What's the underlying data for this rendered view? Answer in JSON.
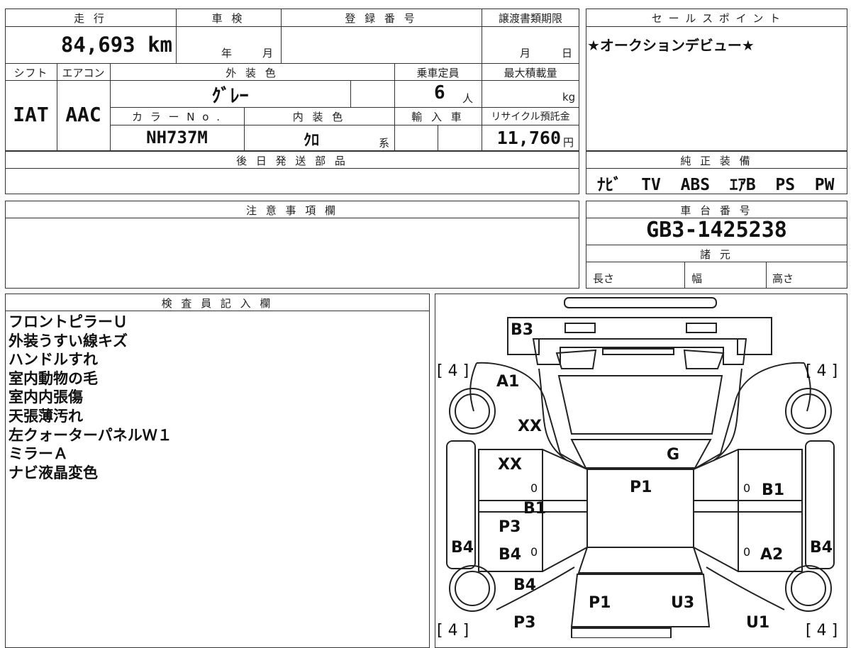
{
  "headers": {
    "mileage": "走 行",
    "inspection": "車 検",
    "registration": "登 録 番 号",
    "transfer_deadline": "譲渡書類期限",
    "sales_point": "セ ー ル ス ポ イ ン ト",
    "shift": "シフト",
    "aircon": "エアコン",
    "exterior_color": "外 装 色",
    "capacity": "乗車定員",
    "max_load": "最大積載量",
    "color_no": "カ ラ ー N o .",
    "interior_color": "内 装 色",
    "import": "輸 入 車",
    "recycle_fee": "リサイクル預託金",
    "later_parts": "後 日 発 送 部 品",
    "genuine_equipment": "純 正 装 備",
    "notes": "注 意 事 項 欄",
    "chassis_no": "車 台 番 号",
    "specs": "諸 元",
    "inspector": "検 査 員 記 入 欄"
  },
  "values": {
    "mileage": "84,693 km",
    "inspection_year": "年",
    "inspection_month": "月",
    "transfer_month": "月",
    "transfer_day": "日",
    "sales_point": "★オークションデビュー★",
    "shift": "IAT",
    "aircon": "AAC",
    "exterior_color": "ｸﾞﾚｰ",
    "capacity": "6",
    "capacity_unit": "人",
    "max_load_unit": "kg",
    "color_no": "NH737M",
    "interior_color": "ｸﾛ",
    "interior_suffix": "系",
    "recycle_fee": "11,760",
    "recycle_unit": "円",
    "genuine_equipment": "ﾅﾋﾞ  TV  ABS  ｴｱB  PS  PW",
    "chassis_no": "GB3-1425238",
    "length_label": "長さ",
    "width_label": "幅",
    "height_label": "高さ"
  },
  "inspector_notes": [
    "フロントピラーＵ",
    "外装うすい線キズ",
    "ハンドルすれ",
    "室内動物の毛",
    "室内内張傷",
    "天張薄汚れ",
    "左クォーターパネルＷ１",
    "ミラーＡ",
    "ナビ液晶変色"
  ],
  "diagram": {
    "b3_top": "B3",
    "tire_fl": "[ 4 ]",
    "tire_fr": "[ 4 ]",
    "tire_rl": "[ 4 ]",
    "tire_rr": "[ 4 ]",
    "a1": "A1",
    "xx_upper": "XX",
    "xx_left_door": "XX",
    "g_roof": "G",
    "p1_center": "P1",
    "b1_right_door": "B1",
    "b1_left": "B1",
    "p3_left": "P3",
    "b4_left_side": "B4",
    "b4_left_door": "B4",
    "a2_right": "A2",
    "b4_right_side": "B4",
    "b4_left_rear": "B4",
    "p1_rear": "P1",
    "u3_rear": "U3",
    "p3_bottom": "P3",
    "u1_right": "U1",
    "zero1": "0",
    "zero2": "0",
    "zero3": "0",
    "zero4": "0"
  }
}
